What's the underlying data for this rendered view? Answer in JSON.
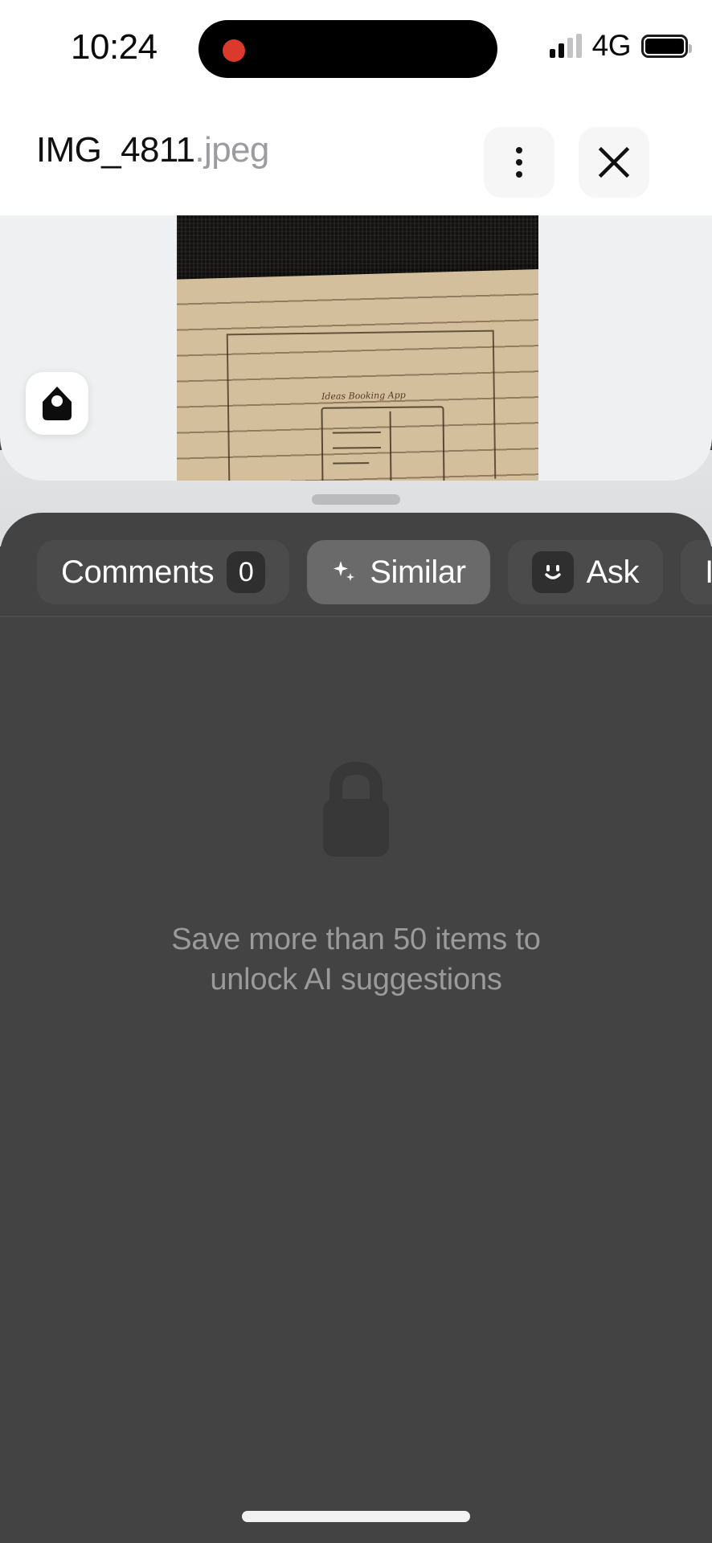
{
  "status_bar": {
    "time": "10:24",
    "network": "4G",
    "recording_indicator": "red-dot",
    "signal_icon": "signal-bars-icon",
    "battery_icon": "battery-icon"
  },
  "header": {
    "filename_base": "IMG_4811",
    "filename_ext": ".jpeg",
    "menu_icon": "more-vertical-icon",
    "close_icon": "close-icon"
  },
  "preview": {
    "logo_icon": "mymind-tag-icon",
    "image_description": "photo of lined notebook page with hand drawn wireframe sketches",
    "handwriting": "Ideas Booking App"
  },
  "sheet": {
    "grabber": "drag-handle",
    "tabs": [
      {
        "label": "Comments",
        "badge": "0",
        "icon": null,
        "active": false
      },
      {
        "label": "Similar",
        "badge": null,
        "icon": "sparkle-icon",
        "active": true
      },
      {
        "label": "Ask",
        "badge": null,
        "icon": "smiley-face-icon",
        "active": false
      },
      {
        "label": "Info",
        "badge": null,
        "icon": null,
        "active": false
      }
    ],
    "locked": {
      "icon": "lock-icon",
      "message": "Save more than 50 items to unlock AI suggestions"
    }
  },
  "colors": {
    "sheet_bg": "#434343",
    "pill_bg": "#4b4b4b",
    "pill_active_bg": "#6a6a6a",
    "badge_bg": "#2f2f2f",
    "locked_text": "#9a9a9a",
    "filename_ext": "#9b9ba1",
    "card_bg": "#eff0f2",
    "record_dot": "#d93a2b"
  }
}
